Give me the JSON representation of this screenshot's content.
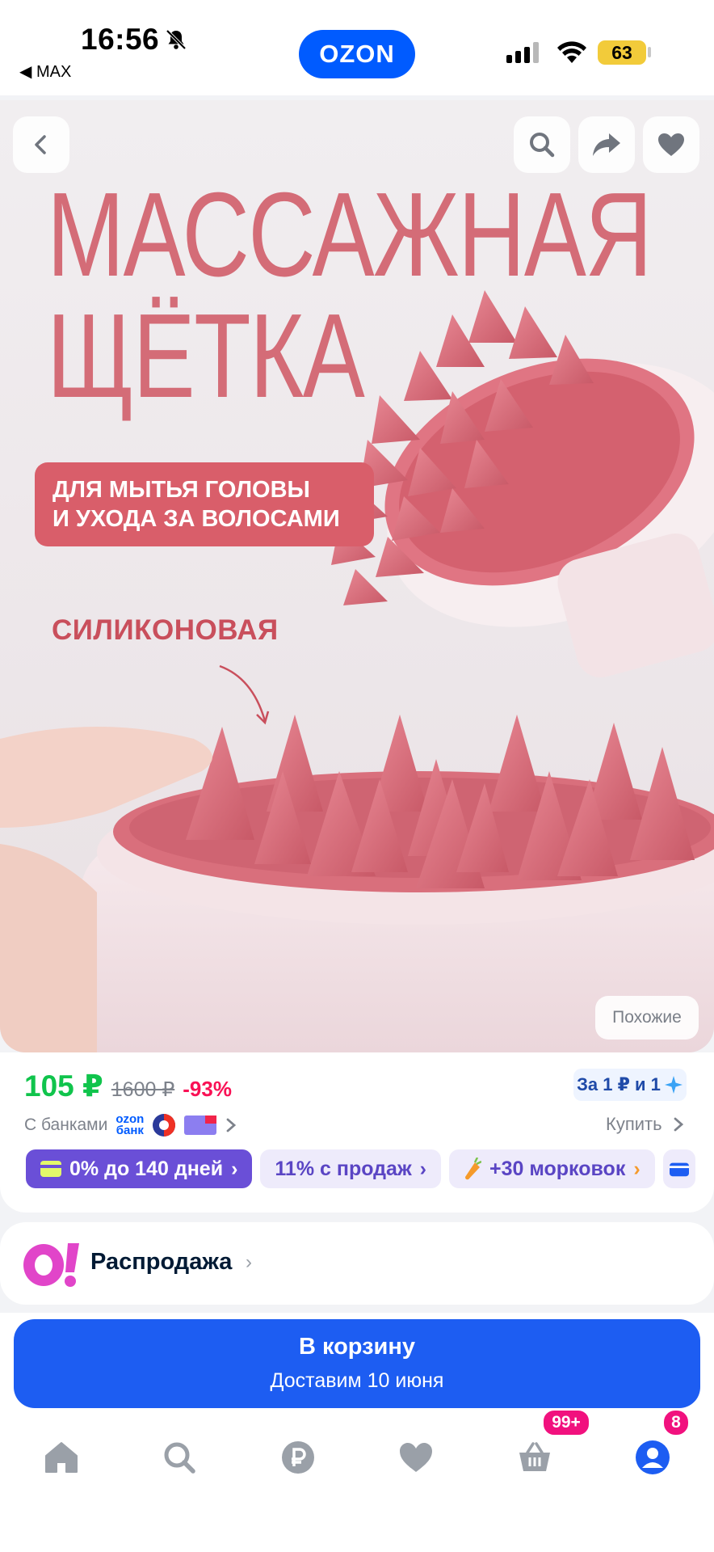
{
  "status_bar": {
    "time": "16:56",
    "back_app": "◀ MAX",
    "battery": "63"
  },
  "brand": {
    "logo": "OZON",
    "accent": "#005bff"
  },
  "hero": {
    "title": "МАССАЖНАЯ\nЩЁТКА",
    "badge": "ДЛЯ МЫТЬЯ ГОЛОВЫ\nИ УХОДА ЗА ВОЛОСАМИ",
    "subtitle": "СИЛИКОНОВАЯ",
    "similar_button": "Похожие",
    "nav_icons": [
      "back-icon",
      "search-icon",
      "share-icon",
      "heart-icon"
    ]
  },
  "price": {
    "current": "105 ₽",
    "old": "1600 ₽",
    "discount": "-93%",
    "promo": "За 1 ₽ и 1",
    "banks_label": "С банками",
    "bank_logo_top": "ozon",
    "bank_logo_bottom": "банк",
    "buy_link": "Купить",
    "current_color": "#10c44c",
    "discount_color": "#f91155"
  },
  "chips": [
    {
      "label": "0% до 140 дней",
      "style": "primary"
    },
    {
      "label": "11% с продаж",
      "style": "light"
    },
    {
      "label": "+30 морковок",
      "style": "light"
    }
  ],
  "sale": {
    "label": "Распродажа"
  },
  "cart_button": {
    "title": "В корзину",
    "subtitle": "Доставим 10 июня"
  },
  "tabbar": {
    "items": [
      "home-icon",
      "search-icon",
      "ruble-icon",
      "favorites-icon",
      "cart-icon",
      "profile-icon"
    ],
    "cart_badge": "99+",
    "profile_badge": "8"
  }
}
